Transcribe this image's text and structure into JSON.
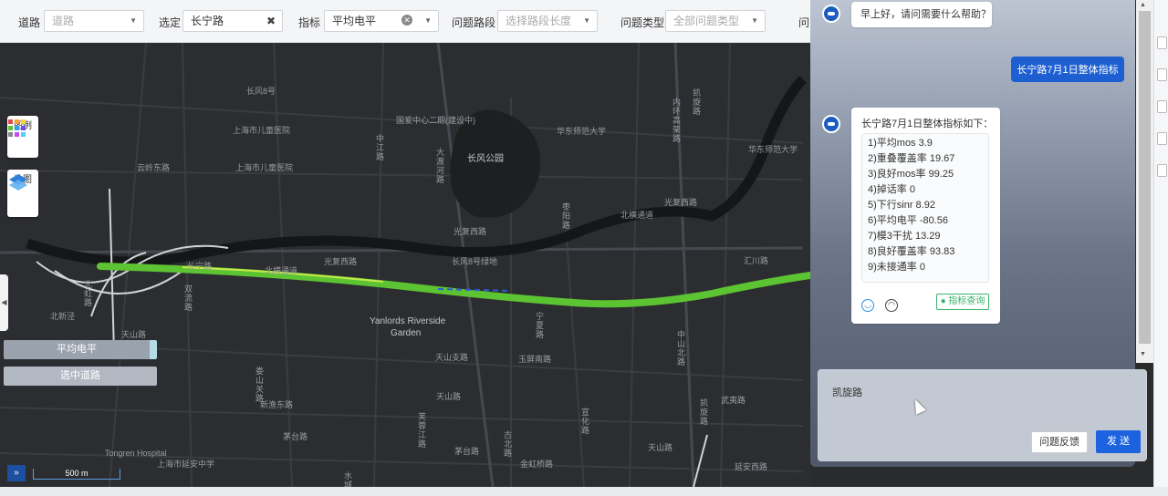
{
  "filters": {
    "road_label": "道路",
    "road_placeholder": "道路",
    "selected_label": "选定",
    "selected_value": "长宁路",
    "metric_label": "指标",
    "metric_value": "平均电平",
    "segment_label": "问题路段",
    "segment_placeholder": "选择路段长度",
    "issue_type_label": "问题类型",
    "issue_type_placeholder": "全部问题类型",
    "more_label": "问"
  },
  "map": {
    "legend_button": "图例",
    "map_button": "地图",
    "layer_avg_level": "平均电平",
    "layer_selected_road": "选中道路",
    "scale": "500 m",
    "expand": "»",
    "labels": {
      "l1": "长风8号",
      "l2": "上海市儿童医院",
      "l3": "上海市儿童医院",
      "l4": "云岭东路",
      "l5": "国爱中心二期(建设中)",
      "l6": "华东师范大学",
      "l7": "长风公园",
      "l8": "光复西路",
      "l9": "光复西路",
      "l10": "北横通道",
      "l11": "北横通道",
      "l12": "光复西路",
      "l13": "华东师范大学",
      "l14": "汇川路",
      "l15": "Yanlords Riverside",
      "l16": "Garden",
      "l17": "天山路",
      "l18": "天山支路",
      "l19": "玉屏南路",
      "l20": "天山路",
      "l21": "新渔东路",
      "l22": "茅台路",
      "l23": "天山路",
      "l24": "茅台路",
      "l25": "Tongren Hospital",
      "l26": "上海市延安中学",
      "l27": "金虹桥路",
      "l28": "武夷路",
      "l29": "延安西路",
      "l30": "长宁路",
      "l31": "北新泾",
      "l32": "凯旋路",
      "l33": "双流路",
      "l34": "北虹路",
      "l35": "中江路",
      "l36": "大渡河路",
      "l37": "枣阳路",
      "l38": "中山北路",
      "l39": "娄山关路",
      "l40": "芙蓉江路",
      "l41": "古北路",
      "l42": "水城路",
      "l43": "宣化路",
      "l44": "凯旋路",
      "l45": "内环高架路",
      "l46": "宁夏路",
      "l47": "长风8号绿地"
    }
  },
  "chat": {
    "greeting": "早上好，请问需要什么帮助？",
    "user_message": "长宁路7月1日整体指标",
    "reply_title": "长宁路7月1日整体指标如下：",
    "metrics": [
      "1)平均mos 3.9",
      "2)重叠覆盖率 19.67",
      "3)良好mos率 99.25",
      "4)掉话率 0",
      "5)下行sinr 8.92",
      "6)平均电平 -80.56",
      "7)模3干扰 13.29",
      "8)良好覆盖率 93.83",
      "9)未接通率 0"
    ],
    "metric_query_button": "指标查询",
    "input_text": "凯旋路",
    "feedback_button": "问题反馈",
    "send_button": "发 送"
  },
  "colors": {
    "accent": "#1d63e0",
    "route": "#5cc332",
    "route_highlight": "#c8e84a"
  }
}
